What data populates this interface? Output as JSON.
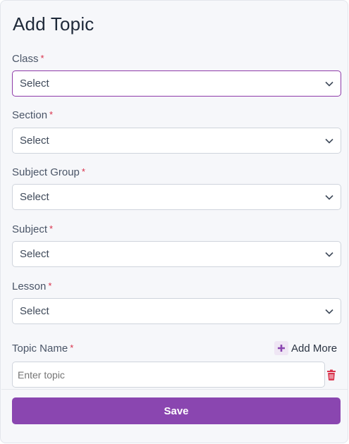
{
  "page": {
    "title": "Add Topic"
  },
  "form": {
    "class": {
      "label": "Class",
      "required": "*",
      "value": "Select"
    },
    "section": {
      "label": "Section",
      "required": "*",
      "value": "Select"
    },
    "subject_group": {
      "label": "Subject Group",
      "required": "*",
      "value": "Select"
    },
    "subject": {
      "label": "Subject",
      "required": "*",
      "value": "Select"
    },
    "lesson": {
      "label": "Lesson",
      "required": "*",
      "value": "Select"
    },
    "topic_name": {
      "label": "Topic Name",
      "required": "*",
      "placeholder": "Enter topic"
    },
    "add_more_label": "Add More",
    "save_label": "Save"
  },
  "icons": {
    "dropdown": "chevron-down-icon",
    "add": "plus-icon",
    "delete": "trash-icon"
  },
  "colors": {
    "primary": "#8a46b0",
    "active_border": "#8e3aa8",
    "required": "#d9314a",
    "delete": "#d9314a"
  }
}
